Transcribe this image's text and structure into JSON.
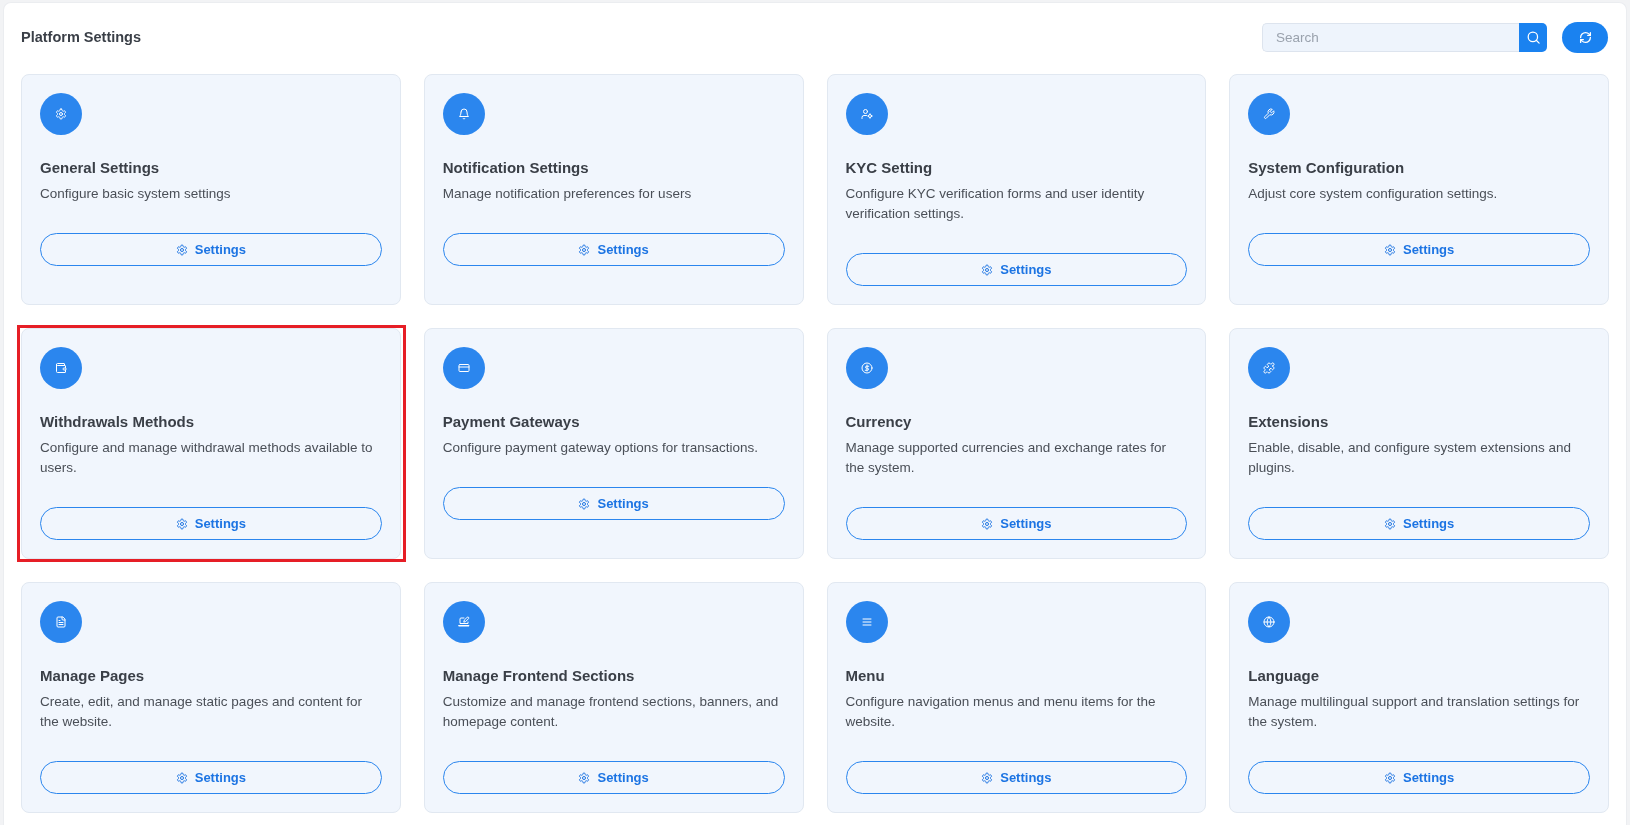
{
  "page": {
    "title": "Platform Settings"
  },
  "search": {
    "placeholder": "Search"
  },
  "cards": [
    {
      "title": "General Settings",
      "description": "Configure basic system settings",
      "button": "Settings",
      "highlighted": false
    },
    {
      "title": "Notification Settings",
      "description": "Manage notification preferences for users",
      "button": "Settings",
      "highlighted": false
    },
    {
      "title": "KYC Setting",
      "description": "Configure KYC verification forms and user identity verification settings.",
      "button": "Settings",
      "highlighted": false
    },
    {
      "title": "System Configuration",
      "description": "Adjust core system configuration settings.",
      "button": "Settings",
      "highlighted": false
    },
    {
      "title": "Withdrawals Methods",
      "description": "Configure and manage withdrawal methods available to users.",
      "button": "Settings",
      "highlighted": true
    },
    {
      "title": "Payment Gateways",
      "description": "Configure payment gateway options for transactions.",
      "button": "Settings",
      "highlighted": false
    },
    {
      "title": "Currency",
      "description": "Manage supported currencies and exchange rates for the system.",
      "button": "Settings",
      "highlighted": false
    },
    {
      "title": "Extensions",
      "description": "Enable, disable, and configure system extensions and plugins.",
      "button": "Settings",
      "highlighted": false
    },
    {
      "title": "Manage Pages",
      "description": "Create, edit, and manage static pages and content for the website.",
      "button": "Settings",
      "highlighted": false
    },
    {
      "title": "Manage Frontend Sections",
      "description": "Customize and manage frontend sections, banners, and homepage content.",
      "button": "Settings",
      "highlighted": false
    },
    {
      "title": "Menu",
      "description": "Configure navigation menus and menu items for the website.",
      "button": "Settings",
      "highlighted": false
    },
    {
      "title": "Language",
      "description": "Manage multilingual support and translation settings for the system.",
      "button": "Settings",
      "highlighted": false
    }
  ]
}
